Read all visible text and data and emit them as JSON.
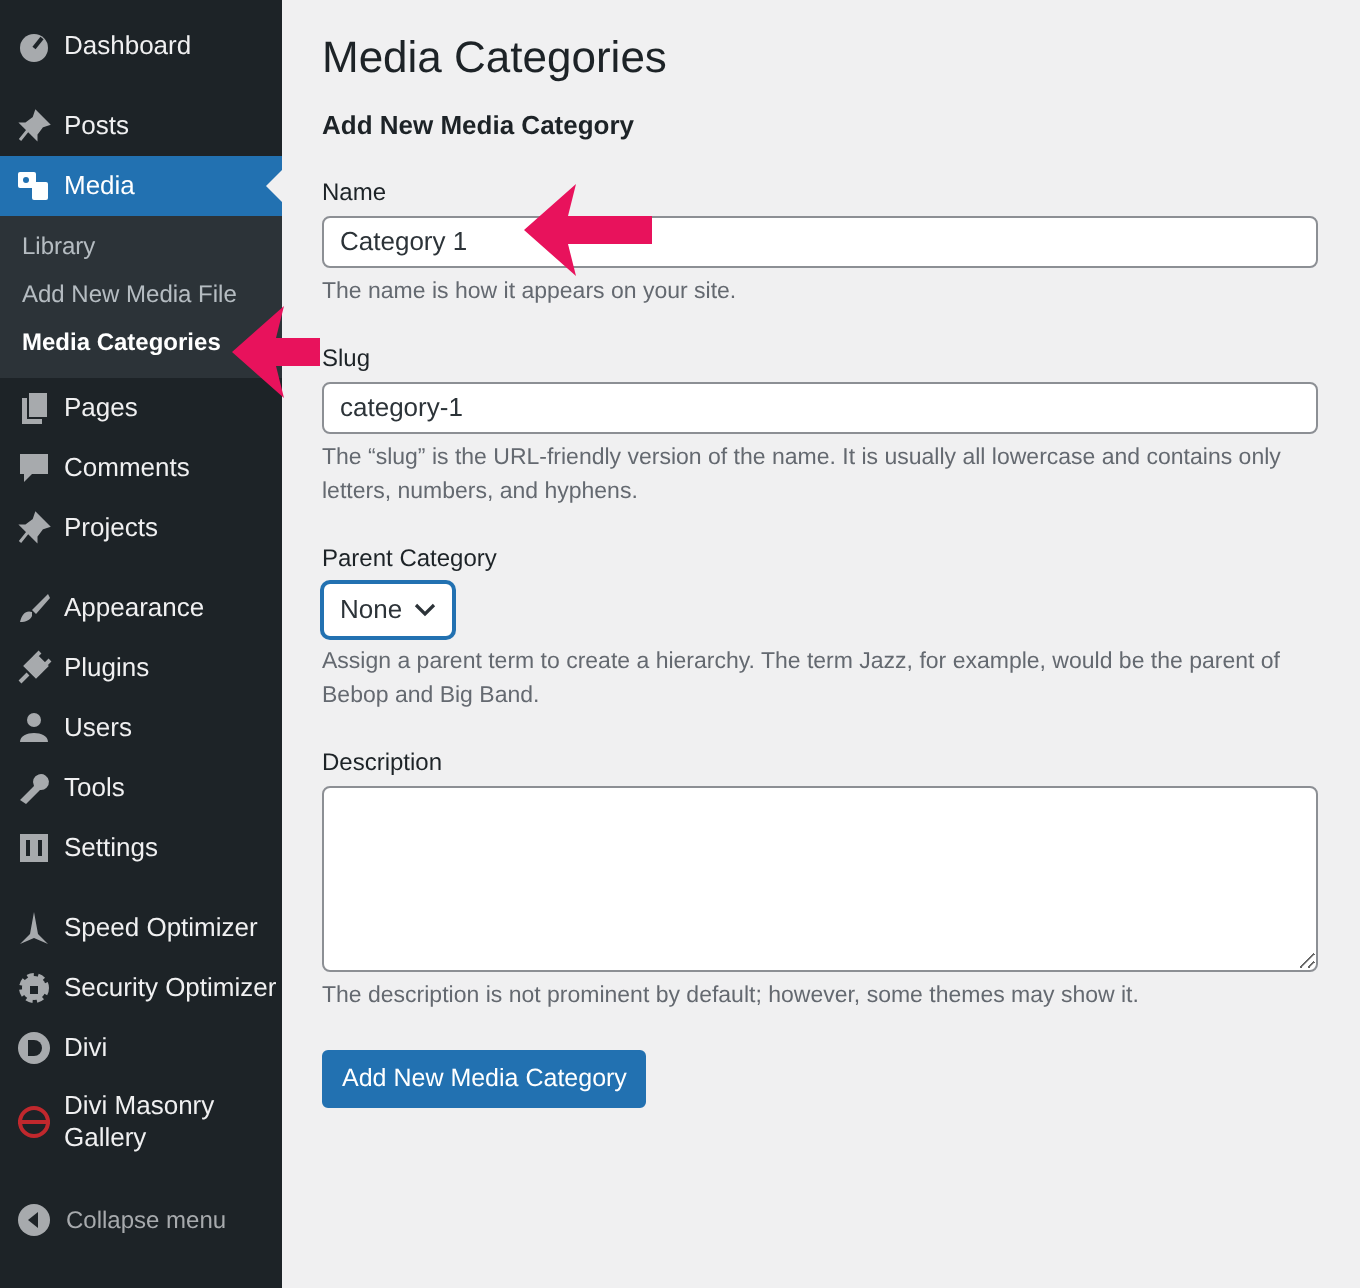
{
  "sidebar": {
    "sections": [
      {
        "items": [
          {
            "label": "Dashboard",
            "selected": false
          }
        ]
      },
      {
        "items": [
          {
            "label": "Posts",
            "selected": false
          },
          {
            "label": "Media",
            "selected": true,
            "children": [
              {
                "label": "Library",
                "selected": false
              },
              {
                "label": "Add New Media File",
                "selected": false
              },
              {
                "label": "Media Categories",
                "selected": true
              }
            ]
          },
          {
            "label": "Pages",
            "selected": false
          },
          {
            "label": "Comments",
            "selected": false
          },
          {
            "label": "Projects",
            "selected": false
          }
        ]
      },
      {
        "items": [
          {
            "label": "Appearance",
            "selected": false
          },
          {
            "label": "Plugins",
            "selected": false
          },
          {
            "label": "Users",
            "selected": false
          },
          {
            "label": "Tools",
            "selected": false
          },
          {
            "label": "Settings",
            "selected": false
          }
        ]
      },
      {
        "items": [
          {
            "label": "Speed Optimizer",
            "selected": false
          },
          {
            "label": "Security Optimizer",
            "selected": false
          },
          {
            "label": "Divi",
            "selected": false
          },
          {
            "label": "Divi Masonry Gallery",
            "selected": false
          }
        ]
      }
    ],
    "collapse": "Collapse menu"
  },
  "page": {
    "title": "Media Categories",
    "form_title": "Add New Media Category",
    "fields": [
      {
        "kind": "text",
        "label": "Name",
        "value": "Category 1",
        "help": "The name is how it appears on your site.",
        "focused": false
      },
      {
        "kind": "text",
        "label": "Slug",
        "value": "category-1",
        "help": "The “slug” is the URL-friendly version of the name. It is usually all lowercase and contains only letters, numbers, and hyphens.",
        "focused": false
      },
      {
        "kind": "select",
        "label": "Parent Category",
        "value": "None",
        "help": "Assign a parent term to create a hierarchy. The term Jazz, for example, would be the parent of Bebop and Big Band.",
        "focused": true
      },
      {
        "kind": "textarea",
        "label": "Description",
        "help": "The description is not prominent by default; however, some themes may show it.",
        "focused": false
      }
    ],
    "submit": "Add New Media Category"
  }
}
